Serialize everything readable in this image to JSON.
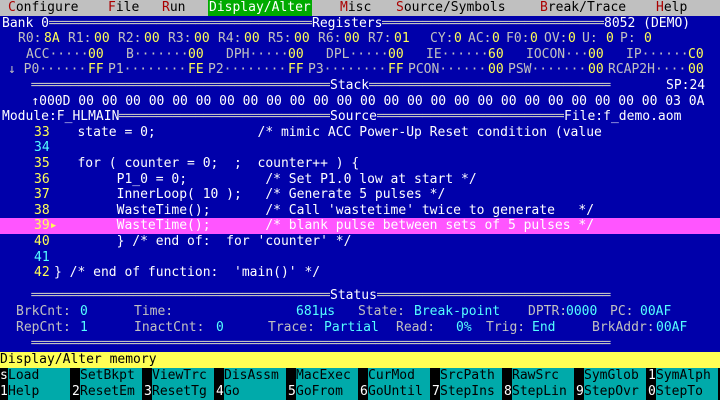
{
  "menu": [
    {
      "label": "Configure",
      "active": false
    },
    {
      "label": "File",
      "active": false
    },
    {
      "label": "Run",
      "active": false
    },
    {
      "label": "Display/Alter",
      "active": true
    },
    {
      "label": "Misc",
      "active": false
    },
    {
      "label": "Source/Symbols",
      "active": false
    },
    {
      "label": "Break/Trace",
      "active": false
    },
    {
      "label": "Help",
      "active": false
    }
  ],
  "registers": {
    "bank_title": "Bank 0",
    "title": "Registers",
    "target": "8052 (DEMO)",
    "row1": [
      [
        "R0:",
        "8A"
      ],
      [
        "R1:",
        "00"
      ],
      [
        "R2:",
        "00"
      ],
      [
        "R3:",
        "00"
      ],
      [
        "R4:",
        "00"
      ],
      [
        "R5:",
        "00"
      ],
      [
        "R6:",
        "00"
      ],
      [
        "R7:",
        "01"
      ]
    ],
    "flags": [
      [
        "CY:",
        "0"
      ],
      [
        "AC:",
        "0"
      ],
      [
        "F0:",
        "0"
      ],
      [
        "OV:",
        "0"
      ],
      [
        "U:",
        "0"
      ],
      [
        "P:",
        "0"
      ]
    ],
    "row2": [
      [
        "ACC",
        "00"
      ],
      [
        "B",
        "00"
      ],
      [
        "DPH",
        "00"
      ],
      [
        "DPL",
        "00"
      ],
      [
        "IE",
        "60"
      ],
      [
        "IOCON",
        "00"
      ],
      [
        "IP",
        "C0"
      ]
    ],
    "row3": [
      [
        "↓ P0",
        "FF"
      ],
      [
        "P1",
        "FE"
      ],
      [
        "P2",
        "FF"
      ],
      [
        "P3",
        "FF"
      ],
      [
        "PCON",
        "00"
      ],
      [
        "PSW",
        "00"
      ],
      [
        "RCAP2H",
        "00"
      ]
    ]
  },
  "stack": {
    "title": "Stack",
    "sp": "SP:24",
    "bytes": "↑000D 00 00 00 00 00 00 00 00 00 00 00 00 00 00 00 00 00 00 00 00 00 00 00 00 00 03 0A"
  },
  "source": {
    "module": "Module:F_HLMAIN",
    "title": "Source",
    "file": "File:f_demo.aom",
    "lines": [
      {
        "num": "33",
        "text": "   state = 0;             /* mimic ACC Power-Up Reset condition (value",
        "hl": false,
        "dim": false
      },
      {
        "num": "34",
        "text": "",
        "hl": false,
        "dim": true
      },
      {
        "num": "35",
        "text": "   for ( counter = 0;  ;  counter++ ) {",
        "hl": false,
        "dim": false
      },
      {
        "num": "36",
        "text": "        P1_0 = 0;          /* Set P1.0 low at start */",
        "hl": false,
        "dim": false
      },
      {
        "num": "37",
        "text": "        InnerLoop( 10 );   /* Generate 5 pulses */",
        "hl": false,
        "dim": false
      },
      {
        "num": "38",
        "text": "        WasteTime();       /* Call 'wastetime' twice to generate   */",
        "hl": false,
        "dim": false
      },
      {
        "num": "39",
        "text": "        WasteTime();       /* blank pulse between sets of 5 pulses */",
        "hl": true,
        "dim": false
      },
      {
        "num": "40",
        "text": "        } /* end of:  for 'counter' */",
        "hl": false,
        "dim": false
      },
      {
        "num": "41",
        "text": "",
        "hl": false,
        "dim": true
      },
      {
        "num": "42",
        "text": "} /* end of function:  'main()' */",
        "hl": false,
        "dim": false
      }
    ]
  },
  "status_panel": {
    "title": "Status",
    "brkcnt_label": "BrkCnt:",
    "brkcnt": "0",
    "time_label": "Time:",
    "time": "681μs",
    "state_label": "State:",
    "state": "Break-point",
    "dptr_label": "DPTR:",
    "dptr": "0000",
    "pc_label": "PC:",
    "pc": "00AF",
    "repcnt_label": "RepCnt:",
    "repcnt": "1",
    "inact_label": "InactCnt:",
    "inact": "0",
    "trace_label": "Trace:",
    "trace": "Partial",
    "read_label": "Read:",
    "read": "0%",
    "trig_label": "Trig:",
    "trig": "End",
    "brkaddr_label": "BrkAddr:",
    "brkaddr": "00AF"
  },
  "status_line": "Display/Alter memory",
  "fkeys1": [
    {
      "n": "s",
      "l": "Load"
    },
    {
      "n": "",
      "l": "SetBkpt"
    },
    {
      "n": "",
      "l": "ViewTrc"
    },
    {
      "n": "",
      "l": "DisAssm"
    },
    {
      "n": "",
      "l": "MacExec"
    },
    {
      "n": "",
      "l": "CurMod"
    },
    {
      "n": "",
      "l": "SrcPath"
    },
    {
      "n": "",
      "l": "RawSrc"
    },
    {
      "n": "",
      "l": "SymGlob"
    },
    {
      "n": "1",
      "l": "SymAlph"
    }
  ],
  "fkeys2": [
    {
      "n": "1",
      "l": "Help"
    },
    {
      "n": "2",
      "l": "ResetEm"
    },
    {
      "n": "3",
      "l": "ResetTg"
    },
    {
      "n": "4",
      "l": "Go"
    },
    {
      "n": "5",
      "l": "GoFrom"
    },
    {
      "n": "6",
      "l": "GoUntil"
    },
    {
      "n": "7",
      "l": "StepIns"
    },
    {
      "n": "8",
      "l": "StepLin"
    },
    {
      "n": "9",
      "l": "StepOvr"
    },
    {
      "n": "0",
      "l": "StepTo"
    }
  ]
}
